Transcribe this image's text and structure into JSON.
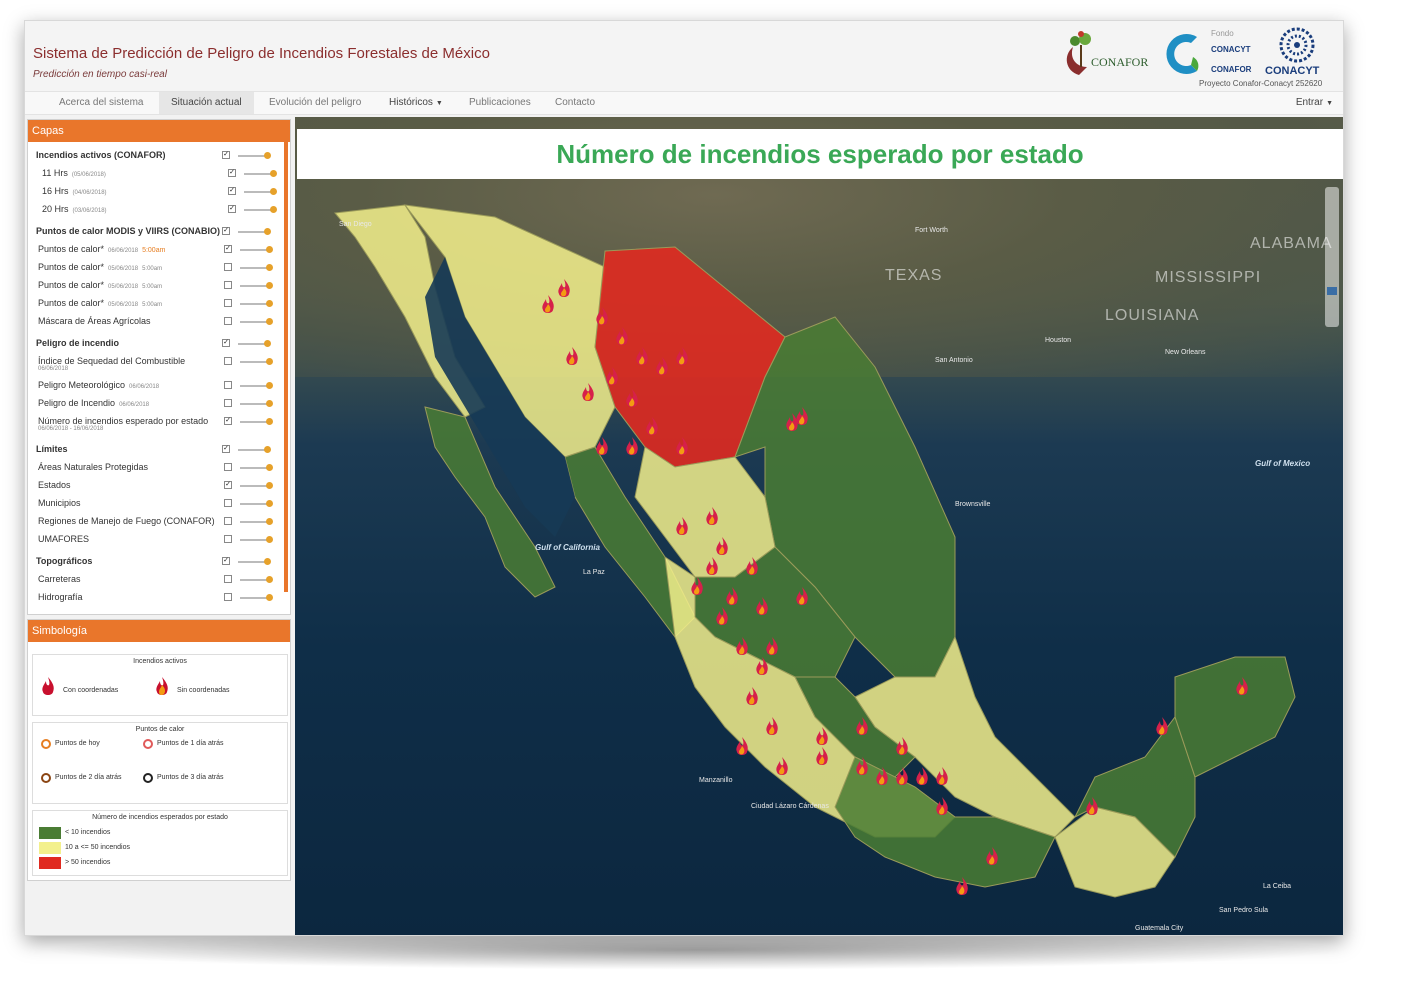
{
  "header": {
    "title": "Sistema de Predicción de Peligro de Incendios Forestales de México",
    "subtitle": "Predicción en tiempo casi-real",
    "logos": {
      "conafor": "CONAFOR",
      "fondo": "Fondo",
      "conacyt_small": "CONACYT",
      "conafor_small": "CONAFOR",
      "conacyt_big": "CONACYT",
      "proyecto": "Proyecto Conafor-Conacyt 252620"
    }
  },
  "nav": {
    "items": [
      "Acerca del sistema",
      "Situación actual",
      "Evolución del peligro",
      "Históricos",
      "Publicaciones",
      "Contacto"
    ],
    "entrar": "Entrar"
  },
  "capas": {
    "title": "Capas",
    "rows": [
      {
        "label": "Incendios activos (CONAFOR)",
        "date": "",
        "checked": true
      },
      {
        "label": "11 Hrs",
        "date": "(05/06/2018)",
        "checked": true
      },
      {
        "label": "16 Hrs",
        "date": "(04/06/2018)",
        "checked": true
      },
      {
        "label": "20 Hrs",
        "date": "(03/06/2018)",
        "checked": true
      },
      {
        "label": "Puntos de calor MODIS y VIIRS (CONABIO)",
        "date": "",
        "checked": true
      },
      {
        "label": "Puntos de calor*",
        "date": "06/06/2018",
        "time": "5:00am",
        "checked": true
      },
      {
        "label": "Puntos de calor*",
        "date": "05/06/2018",
        "time": "5:00am",
        "checked": false
      },
      {
        "label": "Puntos de calor*",
        "date": "05/06/2018",
        "time": "5:00am",
        "checked": false
      },
      {
        "label": "Puntos de calor*",
        "date": "05/06/2018",
        "time": "5:00am",
        "checked": false
      },
      {
        "label": "Máscara de Áreas Agrícolas",
        "date": "",
        "checked": false
      },
      {
        "label": "Peligro de incendio",
        "date": "",
        "checked": true
      },
      {
        "label": "Índice de Sequedad del Combustible",
        "date": "06/06/2018",
        "checked": false
      },
      {
        "label": "Peligro Meteorológico",
        "date": "06/06/2018",
        "checked": false
      },
      {
        "label": "Peligro de Incendio",
        "date": "06/06/2018",
        "checked": false
      },
      {
        "label": "Número de incendios esperado por estado",
        "date": "06/06/2018 - 16/06/2018",
        "checked": true
      },
      {
        "label": "Límites",
        "date": "",
        "checked": true
      },
      {
        "label": "Áreas Naturales Protegidas",
        "date": "",
        "checked": false
      },
      {
        "label": "Estados",
        "date": "",
        "checked": true
      },
      {
        "label": "Municipios",
        "date": "",
        "checked": false
      },
      {
        "label": "Regiones de Manejo de Fuego (CONAFOR)",
        "date": "",
        "checked": false
      },
      {
        "label": "UMAFORES",
        "date": "",
        "checked": false
      },
      {
        "label": "Topográficos",
        "date": "",
        "checked": true
      },
      {
        "label": "Carreteras",
        "date": "",
        "checked": false
      },
      {
        "label": "Hidrografía",
        "date": "",
        "checked": false
      }
    ]
  },
  "simbologia": {
    "title": "Simbología",
    "incendios_title": "Incendios activos",
    "con_coord": "Con coordenadas",
    "sin_coord": "Sin coordenadas",
    "puntos_title": "Puntos de calor",
    "hoy": "Puntos de hoy",
    "uno": "Puntos de 1 día atrás",
    "dos": "Puntos de 2 día atrás",
    "tres": "Puntos de 3 día atrás",
    "numero_title": "Número de incendios esperados por estado",
    "leyenda": [
      {
        "label": "< 10 incendios",
        "color": "#4a7c34"
      },
      {
        "label": "10 a <= 50 incendios",
        "color": "#f3f08c"
      },
      {
        "label": "> 50 incendios",
        "color": "#e02a20"
      }
    ]
  },
  "map": {
    "title": "Número de incendios esperado por estado",
    "labels": {
      "texas": "TEXAS",
      "mississippi": "MISSISSIPPI",
      "louisiana": "LOUISIANA",
      "alabama": "ALABAMA",
      "gulf_mexico": "Gulf of Mexico",
      "gulf_california": "Gulf of California",
      "san_diego": "San Diego",
      "fort_worth": "Fort Worth",
      "san_antonio": "San Antonio",
      "houston": "Houston",
      "new_orleans": "New Orleans",
      "brownsville": "Brownsville",
      "la_paz": "La Paz",
      "manzanillo": "Manzanillo",
      "ciudad_lazaro": "Ciudad Lázaro Cárdenas",
      "guatemala": "Guatemala City",
      "san_pedro": "San Pedro Sula",
      "la_ceiba": "La Ceiba"
    },
    "colors": {
      "green": "#4a7c34",
      "yellow": "#f3f08c",
      "red": "#e02a20"
    }
  }
}
